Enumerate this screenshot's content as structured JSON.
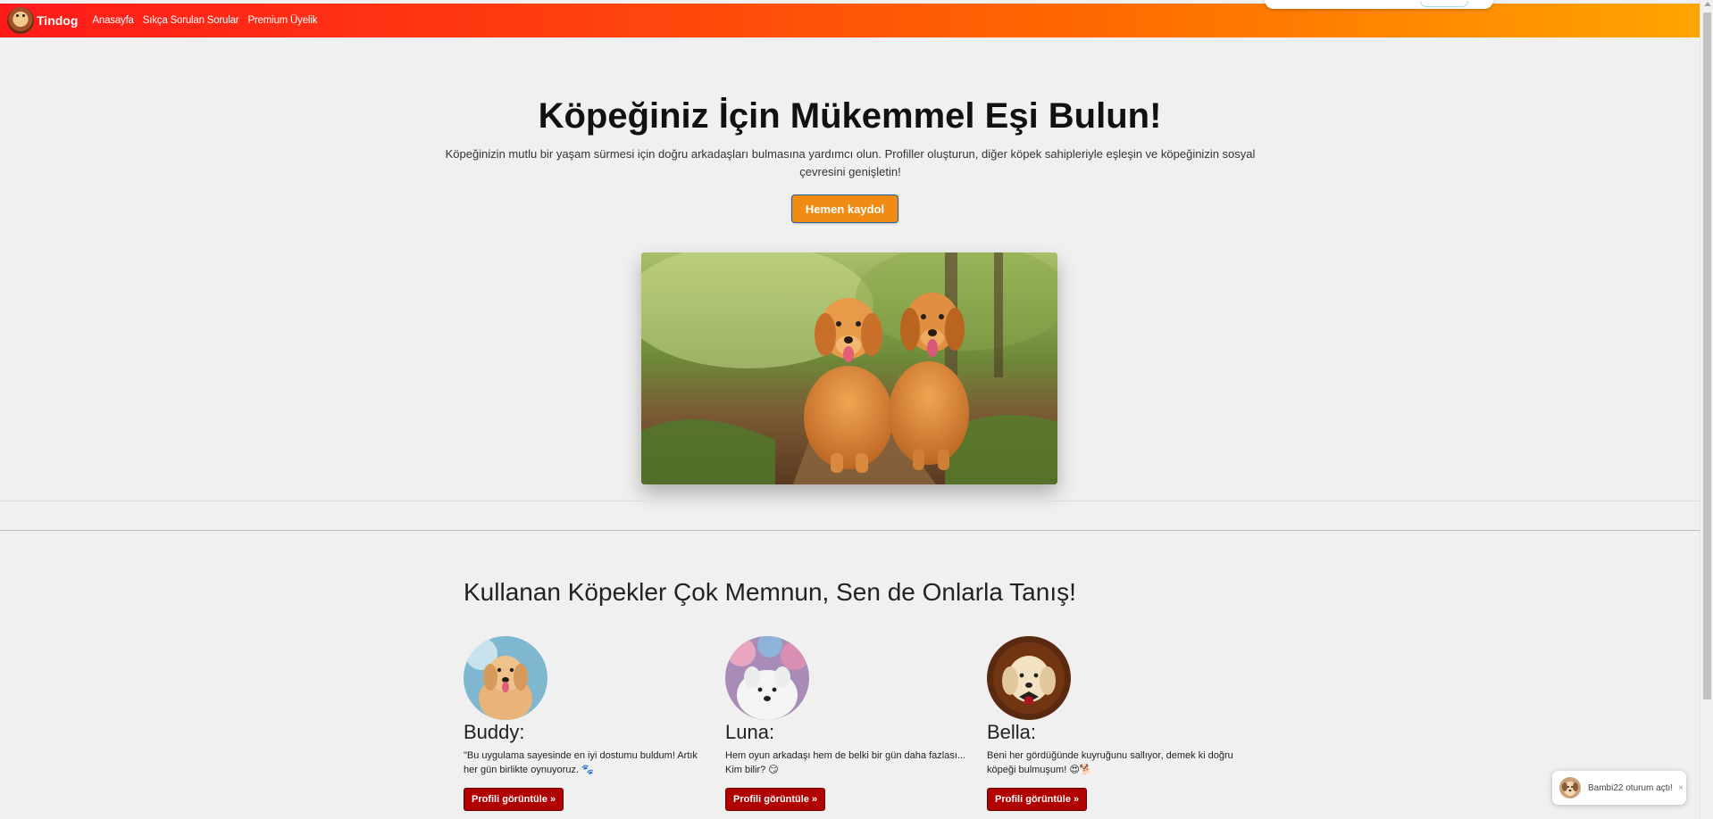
{
  "navbar": {
    "brand": "Tindog",
    "links": [
      "Anasayfa",
      "Sıkça Sorulan Sorular",
      "Premium Üyelik"
    ],
    "gradient_colors": [
      "#ff1a1a",
      "#ffa500"
    ]
  },
  "hero": {
    "title": "Köpeğiniz İçin Mükemmel Eşi Bulun!",
    "description": "Köpeğinizin mutlu bir yaşam sürmesi için doğru arkadaşları bulmasına yardımcı olun. Profiller oluşturun, diğer köpek sahipleriyle eşleşin ve köpeğinizin sosyal çevresini genişletin!",
    "cta_label": "Hemen kaydol",
    "cta_color": "#f08c14"
  },
  "testimonials": {
    "title": "Kullanan Köpekler Çok Memnun, Sen de Onlarla Tanış!",
    "cards": [
      {
        "name": "Buddy:",
        "quote": "\"Bu uygulama sayesinde en iyi dostumu buldum! Artık her gün birlikte oynuyoruz. 🐾",
        "button": "Profili görüntüle »"
      },
      {
        "name": "Luna:",
        "quote": "Hem oyun arkadaşı hem de belki bir gün daha fazlası... Kim bilir? 😏",
        "button": "Profili görüntüle »"
      },
      {
        "name": "Bella:",
        "quote": "Beni her gördüğünde kuyruğunu sallıyor, demek ki doğru köpeği bulmuşum! 😍🐕",
        "button": "Profili görüntüle »"
      }
    ],
    "button_color": "#b00000"
  },
  "toast": {
    "text": "Bambi22 oturum açtı!",
    "close": "×"
  }
}
